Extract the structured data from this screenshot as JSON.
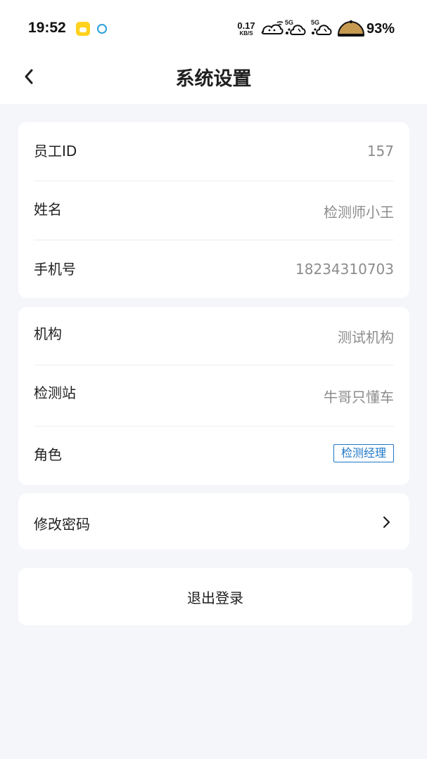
{
  "status_bar": {
    "time": "19:52",
    "net_speed_value": "0.17",
    "net_speed_unit": "KB/S",
    "signal1_label": "5G",
    "signal2_label": "5G",
    "battery": "93%"
  },
  "header": {
    "title": "系统设置"
  },
  "info_card": {
    "rows": [
      {
        "label": "员工ID",
        "value": "157"
      },
      {
        "label": "姓名",
        "value": "检测师小王"
      },
      {
        "label": "手机号",
        "value": "18234310703"
      }
    ]
  },
  "org_card": {
    "rows": [
      {
        "label": "机构",
        "value": "测试机构"
      },
      {
        "label": "检测站",
        "value": "牛哥只懂车"
      }
    ],
    "role_label": "角色",
    "role_value": "检测经理"
  },
  "password_card": {
    "label": "修改密码"
  },
  "logout": {
    "label": "退出登录"
  },
  "colors": {
    "background": "#f5f6fa",
    "accent": "#1e78c8",
    "muted_text": "#8c8c8c"
  }
}
